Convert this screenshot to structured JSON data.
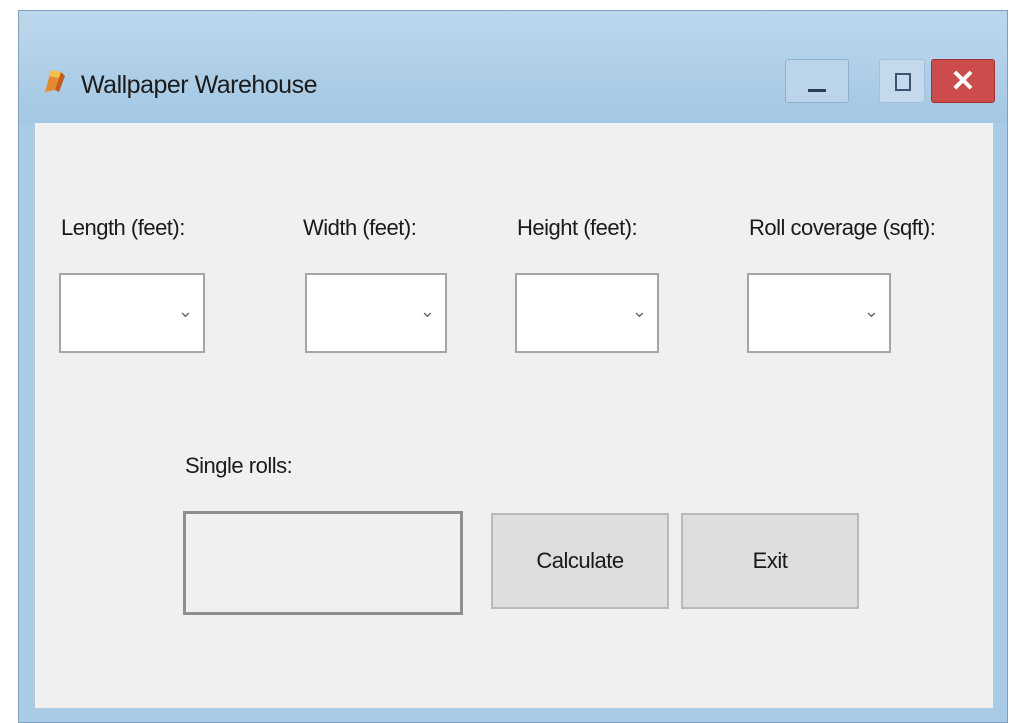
{
  "window": {
    "title": "Wallpaper Warehouse",
    "controls": {
      "minimize": "",
      "maximize": "",
      "close": "✕"
    }
  },
  "fields": [
    {
      "label": "Length (feet):",
      "value": ""
    },
    {
      "label": "Width (feet):",
      "value": ""
    },
    {
      "label": "Height (feet):",
      "value": ""
    },
    {
      "label": "Roll coverage (sqft):",
      "value": ""
    }
  ],
  "dropdown_glyph": "⌄",
  "result": {
    "label": "Single rolls:",
    "value": ""
  },
  "buttons": {
    "calculate": "Calculate",
    "exit": "Exit"
  },
  "colors": {
    "title_bar": "#a9cbe6",
    "client_area": "#f0f0f0",
    "close_button": "#cc4b4b",
    "button_face": "#dedede"
  }
}
